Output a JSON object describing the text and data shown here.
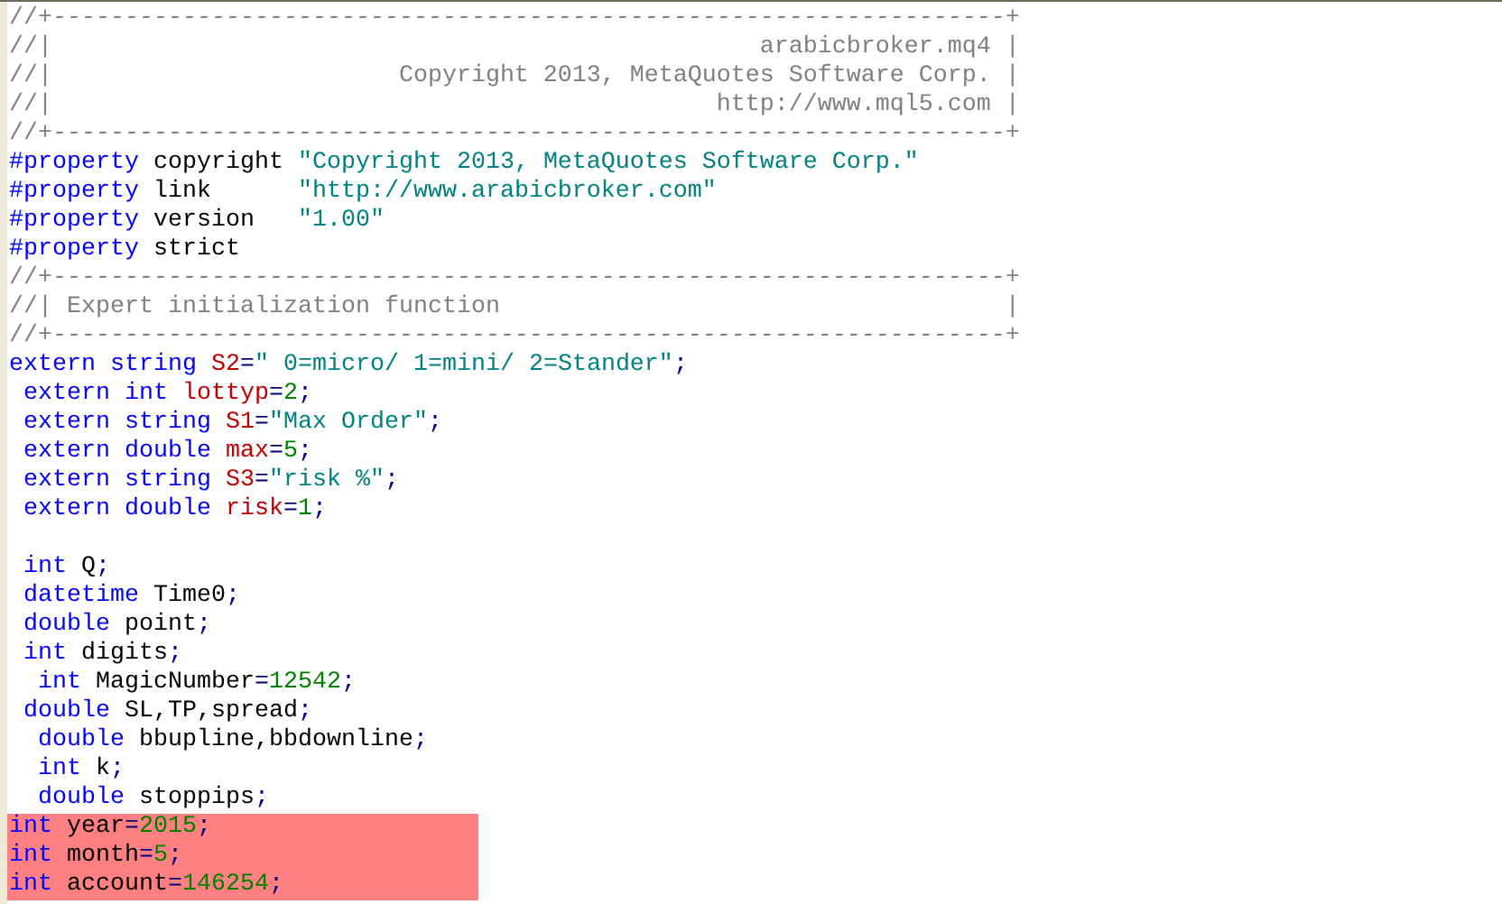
{
  "editor": {
    "lines": [
      {
        "selected": false,
        "tokens": [
          {
            "kind": "comment",
            "text": "//+------------------------------------------------------------------+"
          }
        ]
      },
      {
        "selected": false,
        "tokens": [
          {
            "kind": "comment",
            "text": "//|                                                 arabicbroker.mq4 |"
          }
        ]
      },
      {
        "selected": false,
        "tokens": [
          {
            "kind": "comment",
            "text": "//|                        Copyright 2013, MetaQuotes Software Corp. |"
          }
        ]
      },
      {
        "selected": false,
        "tokens": [
          {
            "kind": "comment",
            "text": "//|                                              http://www.mql5.com |"
          }
        ]
      },
      {
        "selected": false,
        "tokens": [
          {
            "kind": "comment",
            "text": "//+------------------------------------------------------------------+"
          }
        ]
      },
      {
        "selected": false,
        "tokens": [
          {
            "kind": "keyword",
            "text": "#property"
          },
          {
            "kind": "plain",
            "text": " copyright "
          },
          {
            "kind": "string",
            "text": "\"Copyright 2013, MetaQuotes Software Corp.\""
          }
        ]
      },
      {
        "selected": false,
        "tokens": [
          {
            "kind": "keyword",
            "text": "#property"
          },
          {
            "kind": "plain",
            "text": " link      "
          },
          {
            "kind": "string",
            "text": "\"http://www.arabicbroker.com\""
          }
        ]
      },
      {
        "selected": false,
        "tokens": [
          {
            "kind": "keyword",
            "text": "#property"
          },
          {
            "kind": "plain",
            "text": " version   "
          },
          {
            "kind": "string",
            "text": "\"1.00\""
          }
        ]
      },
      {
        "selected": false,
        "tokens": [
          {
            "kind": "keyword",
            "text": "#property"
          },
          {
            "kind": "plain",
            "text": " strict"
          }
        ]
      },
      {
        "selected": false,
        "tokens": [
          {
            "kind": "comment",
            "text": "//+------------------------------------------------------------------+"
          }
        ]
      },
      {
        "selected": false,
        "tokens": [
          {
            "kind": "comment",
            "text": "//| Expert initialization function                                   |"
          }
        ]
      },
      {
        "selected": false,
        "tokens": [
          {
            "kind": "comment",
            "text": "//+------------------------------------------------------------------+"
          }
        ]
      },
      {
        "selected": false,
        "tokens": [
          {
            "kind": "keyword",
            "text": "extern string "
          },
          {
            "kind": "variable",
            "text": "S2"
          },
          {
            "kind": "operator",
            "text": "="
          },
          {
            "kind": "string",
            "text": "\" 0=micro/ 1=mini/ 2=Stander\""
          },
          {
            "kind": "operator",
            "text": ";"
          }
        ]
      },
      {
        "selected": false,
        "tokens": [
          {
            "kind": "keyword",
            "text": " extern int "
          },
          {
            "kind": "variable",
            "text": "lottyp"
          },
          {
            "kind": "operator",
            "text": "="
          },
          {
            "kind": "number",
            "text": "2"
          },
          {
            "kind": "operator",
            "text": ";"
          }
        ]
      },
      {
        "selected": false,
        "tokens": [
          {
            "kind": "keyword",
            "text": " extern string "
          },
          {
            "kind": "variable",
            "text": "S1"
          },
          {
            "kind": "operator",
            "text": "="
          },
          {
            "kind": "string",
            "text": "\"Max Order\""
          },
          {
            "kind": "operator",
            "text": ";"
          }
        ]
      },
      {
        "selected": false,
        "tokens": [
          {
            "kind": "keyword",
            "text": " extern double "
          },
          {
            "kind": "variable",
            "text": "max"
          },
          {
            "kind": "operator",
            "text": "="
          },
          {
            "kind": "number",
            "text": "5"
          },
          {
            "kind": "operator",
            "text": ";"
          }
        ]
      },
      {
        "selected": false,
        "tokens": [
          {
            "kind": "keyword",
            "text": " extern string "
          },
          {
            "kind": "variable",
            "text": "S3"
          },
          {
            "kind": "operator",
            "text": "="
          },
          {
            "kind": "string",
            "text": "\"risk %\""
          },
          {
            "kind": "operator",
            "text": ";"
          }
        ]
      },
      {
        "selected": false,
        "tokens": [
          {
            "kind": "keyword",
            "text": " extern double "
          },
          {
            "kind": "variable",
            "text": "risk"
          },
          {
            "kind": "operator",
            "text": "="
          },
          {
            "kind": "number",
            "text": "1"
          },
          {
            "kind": "operator",
            "text": ";"
          }
        ]
      },
      {
        "kind": "blank"
      },
      {
        "selected": false,
        "tokens": [
          {
            "kind": "keyword",
            "text": " int"
          },
          {
            "kind": "plain",
            "text": " Q"
          },
          {
            "kind": "operator",
            "text": ";"
          }
        ]
      },
      {
        "selected": false,
        "tokens": [
          {
            "kind": "keyword",
            "text": " datetime"
          },
          {
            "kind": "plain",
            "text": " Time0"
          },
          {
            "kind": "operator",
            "text": ";"
          }
        ]
      },
      {
        "selected": false,
        "tokens": [
          {
            "kind": "keyword",
            "text": " double"
          },
          {
            "kind": "plain",
            "text": " point"
          },
          {
            "kind": "operator",
            "text": ";"
          }
        ]
      },
      {
        "selected": false,
        "tokens": [
          {
            "kind": "keyword",
            "text": " int"
          },
          {
            "kind": "plain",
            "text": " digits"
          },
          {
            "kind": "operator",
            "text": ";"
          }
        ]
      },
      {
        "selected": false,
        "tokens": [
          {
            "kind": "keyword",
            "text": "  int"
          },
          {
            "kind": "plain",
            "text": " MagicNumber"
          },
          {
            "kind": "operator",
            "text": "="
          },
          {
            "kind": "number",
            "text": "12542"
          },
          {
            "kind": "operator",
            "text": ";"
          }
        ]
      },
      {
        "selected": false,
        "tokens": [
          {
            "kind": "keyword",
            "text": " double"
          },
          {
            "kind": "plain",
            "text": " SL,TP,spread"
          },
          {
            "kind": "operator",
            "text": ";"
          }
        ]
      },
      {
        "selected": false,
        "tokens": [
          {
            "kind": "keyword",
            "text": "  double"
          },
          {
            "kind": "plain",
            "text": " bbupline,bbdownline"
          },
          {
            "kind": "operator",
            "text": ";"
          }
        ]
      },
      {
        "selected": false,
        "tokens": [
          {
            "kind": "keyword",
            "text": "  int"
          },
          {
            "kind": "plain",
            "text": " k"
          },
          {
            "kind": "operator",
            "text": ";"
          }
        ]
      },
      {
        "selected": false,
        "tokens": [
          {
            "kind": "keyword",
            "text": "  double"
          },
          {
            "kind": "plain",
            "text": " stoppips"
          },
          {
            "kind": "operator",
            "text": ";"
          }
        ]
      },
      {
        "selected": true,
        "tokens": [
          {
            "kind": "keyword",
            "text": "int"
          },
          {
            "kind": "plain",
            "text": " year"
          },
          {
            "kind": "operator",
            "text": "="
          },
          {
            "kind": "number",
            "text": "2015"
          },
          {
            "kind": "operator",
            "text": ";"
          }
        ]
      },
      {
        "selected": true,
        "tokens": [
          {
            "kind": "keyword",
            "text": "int"
          },
          {
            "kind": "plain",
            "text": " month"
          },
          {
            "kind": "operator",
            "text": "="
          },
          {
            "kind": "number",
            "text": "5"
          },
          {
            "kind": "operator",
            "text": ";"
          }
        ]
      },
      {
        "selected": true,
        "tokens": [
          {
            "kind": "keyword",
            "text": "int"
          },
          {
            "kind": "plain",
            "text": " account"
          },
          {
            "kind": "operator",
            "text": "="
          },
          {
            "kind": "number",
            "text": "146254"
          },
          {
            "kind": "operator",
            "text": ";"
          }
        ]
      }
    ]
  }
}
